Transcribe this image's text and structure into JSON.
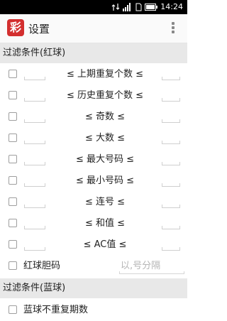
{
  "status_bar": {
    "time": "14:24",
    "network": "4G"
  },
  "app_bar": {
    "logo_char": "彩",
    "title": "设置"
  },
  "section_red": {
    "title": "过滤条件(红球)"
  },
  "red_filters": [
    {
      "label": "≤ 上期重复个数 ≤"
    },
    {
      "label": "≤ 历史重复个数 ≤"
    },
    {
      "label": "≤ 奇数 ≤"
    },
    {
      "label": "≤ 大数 ≤"
    },
    {
      "label": "≤ 最大号码 ≤"
    },
    {
      "label": "≤ 最小号码 ≤"
    },
    {
      "label": "≤ 连号 ≤"
    },
    {
      "label": "≤ 和值 ≤"
    },
    {
      "label": "≤ AC值 ≤"
    }
  ],
  "red_banker": {
    "label": "红球胆码",
    "placeholder": "以,号分隔"
  },
  "section_blue": {
    "title": "过滤条件(蓝球)"
  },
  "blue_filters": [
    {
      "label": "蓝球不重复期数"
    }
  ],
  "colors": {
    "logo_red": "#d32f2f",
    "header_gray": "#e8e8e8"
  }
}
